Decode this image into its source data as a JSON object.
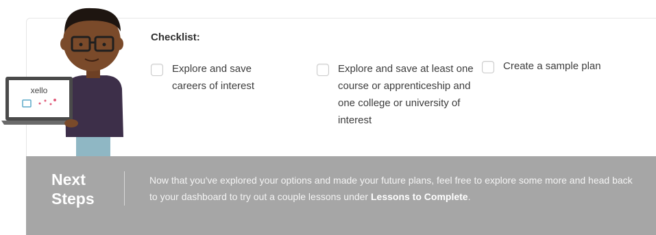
{
  "checklist": {
    "title": "Checklist:",
    "items": [
      {
        "label": "Explore and save careers of interest",
        "checked": false
      },
      {
        "label": "Explore and save at least one course or apprenticeship and one college or university of interest",
        "checked": false
      },
      {
        "label": "Create a sample plan",
        "checked": false
      }
    ]
  },
  "next_steps": {
    "title": "Next Steps",
    "text_before": "Now that you've explored your options and made your future plans, feel free to explore some more and head back to your dashboard to try out a couple lessons under ",
    "text_link": "Lessons to Complete",
    "text_after": "."
  },
  "illustration": {
    "laptop_logo": "xello",
    "icon": "person-with-laptop-icon"
  },
  "colors": {
    "banner_bg": "#a6a6a6",
    "skin": "#7a4a2a",
    "shirt": "#3d2f49",
    "pants": "#8fb7c4"
  }
}
